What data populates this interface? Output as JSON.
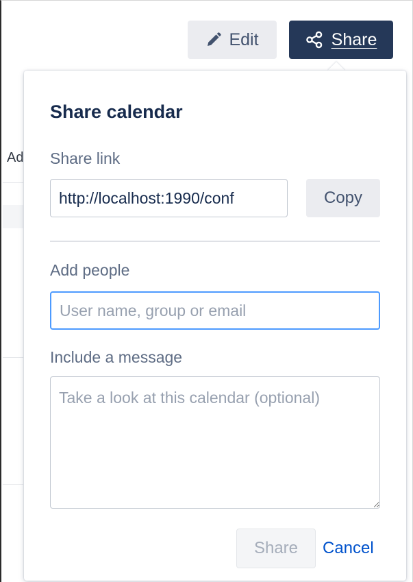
{
  "toolbar": {
    "edit_label": "Edit",
    "edit_icon": "pencil-icon",
    "share_label": "Share",
    "share_icon": "share-nodes-icon"
  },
  "background": {
    "peek_text": "Ad"
  },
  "dialog": {
    "title": "Share calendar",
    "share_link": {
      "label": "Share link",
      "value": "http://localhost:1990/conf",
      "copy_label": "Copy"
    },
    "add_people": {
      "label": "Add people",
      "placeholder": "User name, group or email",
      "value": ""
    },
    "message": {
      "label": "Include a message",
      "placeholder": "Take a look at this calendar (optional)",
      "value": ""
    },
    "submit_label": "Share",
    "cancel_label": "Cancel"
  },
  "colors": {
    "primary_dark": "#253858",
    "link_blue": "#0052cc",
    "focus_blue": "#4c9aff",
    "neutral_button": "#ebecf0"
  }
}
